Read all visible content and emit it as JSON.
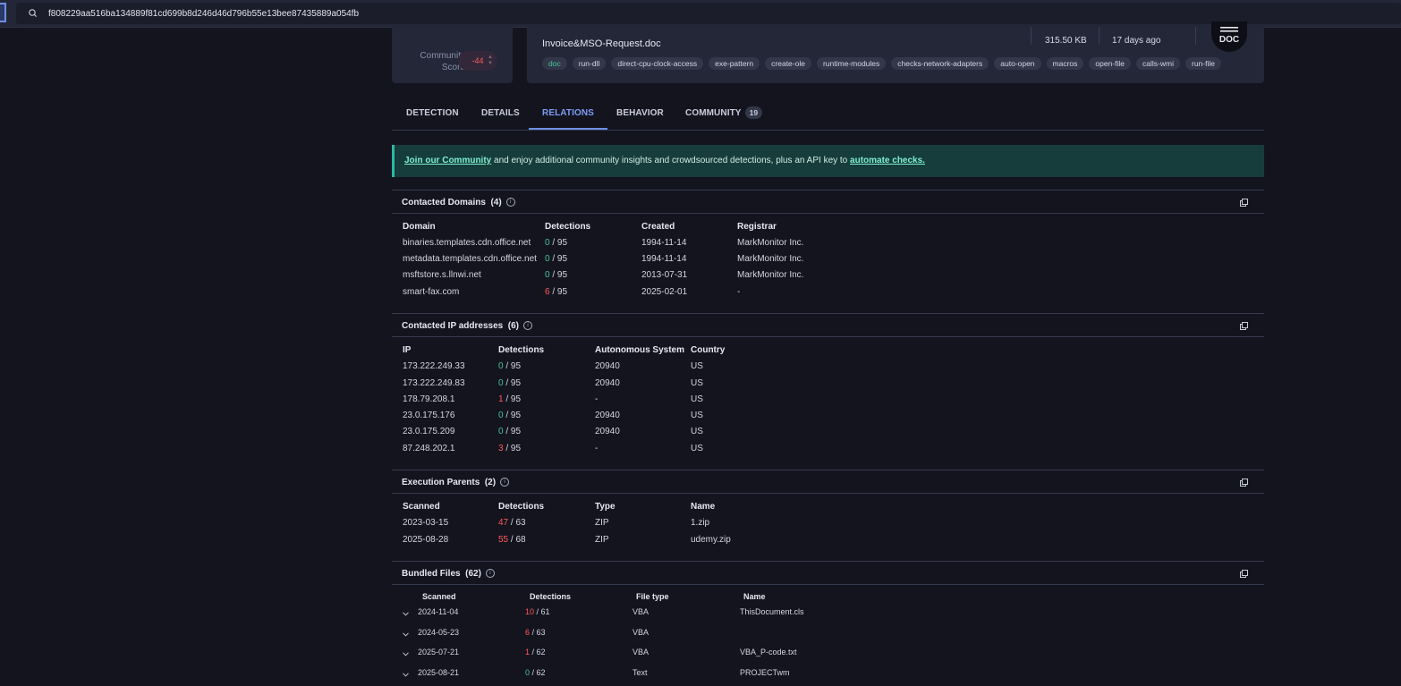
{
  "search": {
    "value": "f808229aa516ba134889f81cd699b8d246d46d796b55e13bee87435889a054fb"
  },
  "score": {
    "label_line1": "Community",
    "label_line2": "Score",
    "value": "-44",
    "ring_color": "#f0544f"
  },
  "file": {
    "name": "Invoice&MSO-Request.doc",
    "size": "315.50 KB",
    "age": "17 days ago",
    "type_icon": "DOC",
    "tags": [
      "doc",
      "run-dll",
      "direct-cpu-clock-access",
      "exe-pattern",
      "create-ole",
      "runtime-modules",
      "checks-network-adapters",
      "auto-open",
      "macros",
      "open-file",
      "calls-wmi",
      "run-file"
    ]
  },
  "tabs": {
    "detection": "DETECTION",
    "details": "DETAILS",
    "relations": "RELATIONS",
    "behavior": "BEHAVIOR",
    "community": "COMMUNITY",
    "community_count": "19"
  },
  "banner": {
    "link1": "Join our Community",
    "middle": " and enjoy additional community insights and crowdsourced detections, plus an API key to ",
    "link2": "automate checks."
  },
  "domains": {
    "title": "Contacted Domains",
    "count": "(4)",
    "headers": [
      "Domain",
      "Detections",
      "Created",
      "Registrar"
    ],
    "rows": [
      {
        "domain": "binaries.templates.cdn.office.net",
        "det": "0",
        "total": " / 95",
        "created": "1994-11-14",
        "registrar": "MarkMonitor Inc."
      },
      {
        "domain": "metadata.templates.cdn.office.net",
        "det": "0",
        "total": " / 95",
        "created": "1994-11-14",
        "registrar": "MarkMonitor Inc."
      },
      {
        "domain": "msftstore.s.llnwi.net",
        "det": "0",
        "total": " / 95",
        "created": "2013-07-31",
        "registrar": "MarkMonitor Inc."
      },
      {
        "domain": "smart-fax.com",
        "det": "6",
        "total": " / 95",
        "created": "2025-02-01",
        "registrar": "-"
      }
    ]
  },
  "ips": {
    "title": "Contacted IP addresses",
    "count": "(6)",
    "headers": [
      "IP",
      "Detections",
      "Autonomous System",
      "Country"
    ],
    "rows": [
      {
        "ip": "173.222.249.33",
        "det": "0",
        "total": " / 95",
        "as": "20940",
        "country": "US"
      },
      {
        "ip": "173.222.249.83",
        "det": "0",
        "total": " / 95",
        "as": "20940",
        "country": "US"
      },
      {
        "ip": "178.79.208.1",
        "det": "1",
        "total": " / 95",
        "as": "-",
        "country": "US"
      },
      {
        "ip": "23.0.175.176",
        "det": "0",
        "total": " / 95",
        "as": "20940",
        "country": "US"
      },
      {
        "ip": "23.0.175.209",
        "det": "0",
        "total": " / 95",
        "as": "20940",
        "country": "US"
      },
      {
        "ip": "87.248.202.1",
        "det": "3",
        "total": " / 95",
        "as": "-",
        "country": "US"
      }
    ]
  },
  "parents": {
    "title": "Execution Parents",
    "count": "(2)",
    "headers": [
      "Scanned",
      "Detections",
      "Type",
      "Name"
    ],
    "rows": [
      {
        "scanned": "2023-03-15",
        "det": "47",
        "total": " / 63",
        "type": "ZIP",
        "name": "1.zip"
      },
      {
        "scanned": "2025-08-28",
        "det": "55",
        "total": " / 68",
        "type": "ZIP",
        "name": "udemy.zip"
      }
    ]
  },
  "bundled": {
    "title": "Bundled Files",
    "count": "(62)",
    "headers": [
      "Scanned",
      "Detections",
      "File type",
      "Name"
    ],
    "rows": [
      {
        "scanned": "2024-11-04",
        "det": "10",
        "total": " / 61",
        "type": "VBA",
        "name": "ThisDocument.cls"
      },
      {
        "scanned": "2024-05-23",
        "det": "6",
        "total": " / 63",
        "type": "VBA",
        "name": ""
      },
      {
        "scanned": "2025-07-21",
        "det": "1",
        "total": " / 62",
        "type": "VBA",
        "name": "VBA_P-code.txt"
      },
      {
        "scanned": "2025-08-21",
        "det": "0",
        "total": " / 62",
        "type": "Text",
        "name": "PROJECTwm"
      }
    ]
  }
}
